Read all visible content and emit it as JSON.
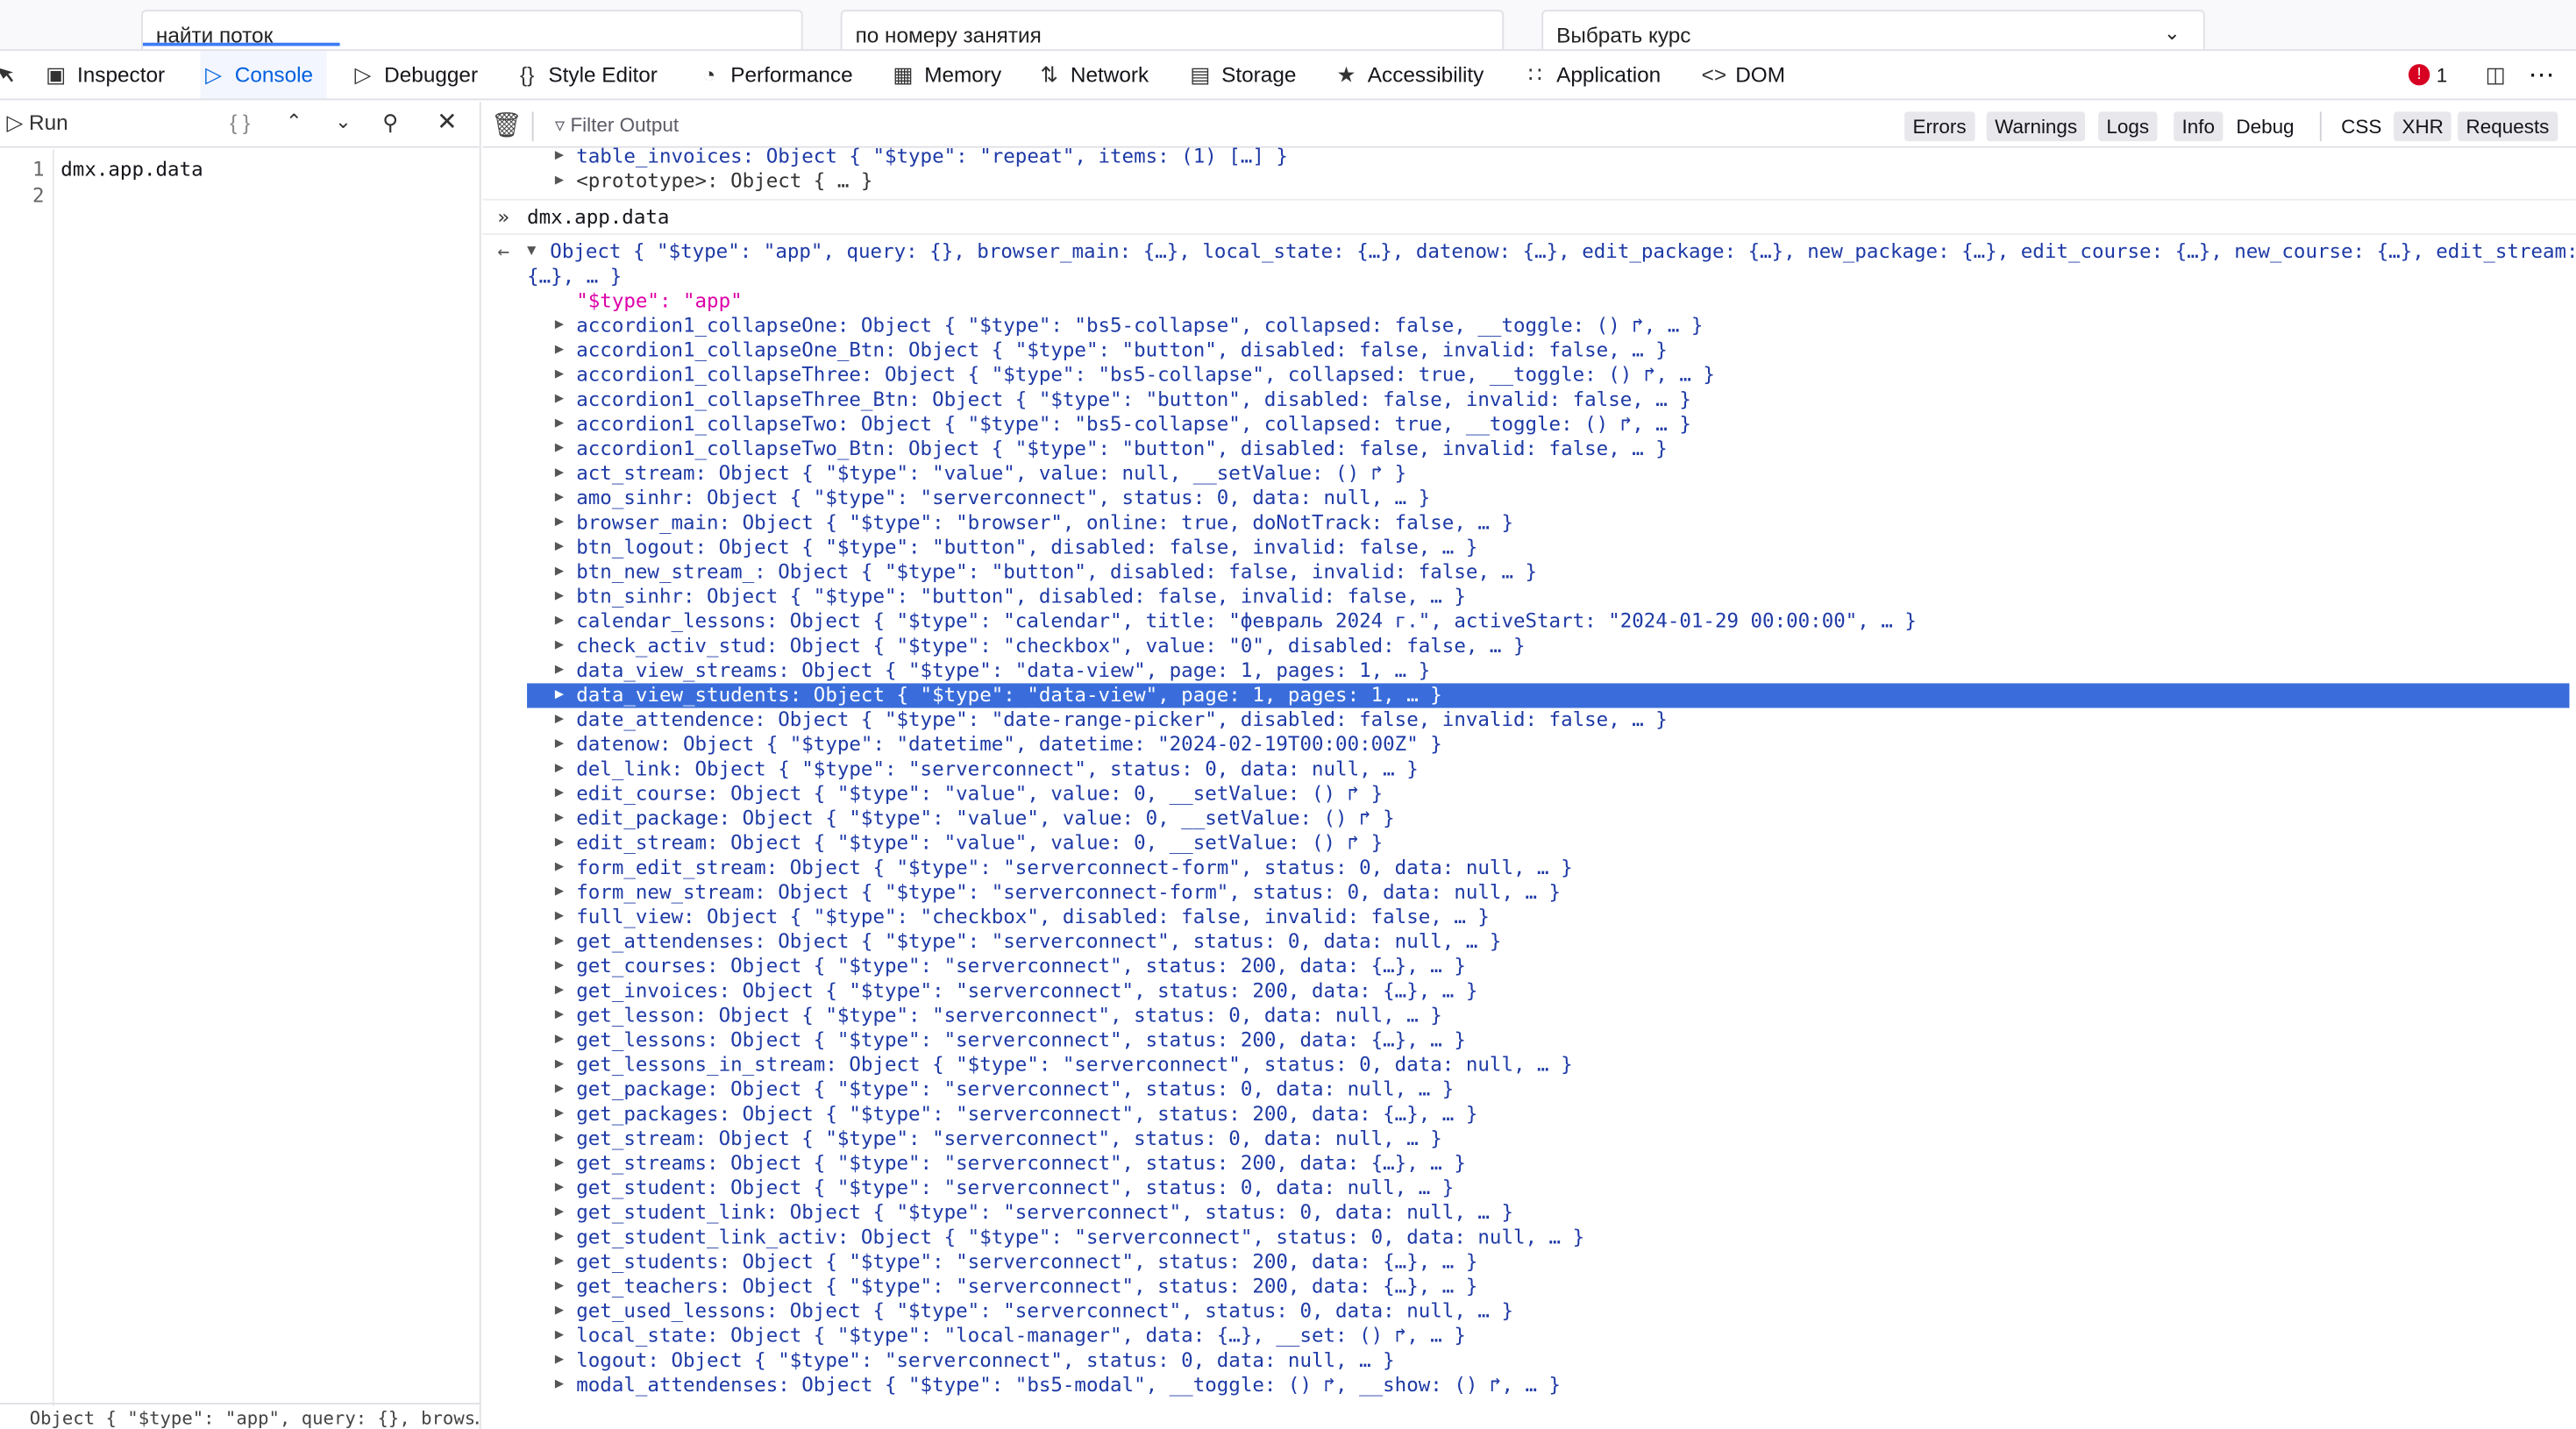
{
  "page": {
    "inputs": [
      {
        "value": "найти поток"
      },
      {
        "value": "по номеру занятия"
      },
      {
        "value": "Выбрать курс"
      }
    ]
  },
  "toolbar": {
    "tabs": [
      {
        "label": "Inspector",
        "icon": "inspector-icon"
      },
      {
        "label": "Console",
        "icon": "console-icon"
      },
      {
        "label": "Debugger",
        "icon": "debugger-icon"
      },
      {
        "label": "Style Editor",
        "icon": "style-editor-icon"
      },
      {
        "label": "Performance",
        "icon": "performance-icon"
      },
      {
        "label": "Memory",
        "icon": "memory-icon"
      },
      {
        "label": "Network",
        "icon": "network-icon"
      },
      {
        "label": "Storage",
        "icon": "storage-icon"
      },
      {
        "label": "Accessibility",
        "icon": "accessibility-icon"
      },
      {
        "label": "Application",
        "icon": "application-icon"
      },
      {
        "label": "DOM",
        "icon": "dom-icon"
      }
    ],
    "error_count": "1",
    "active_tab": "Console"
  },
  "editor": {
    "run_label": "Run",
    "braces": "{ }",
    "lines": [
      "1",
      "2"
    ],
    "code": "dmx.app.data",
    "footer": "Object { \"$type\": \"app\", query: {}, brows…"
  },
  "filter": {
    "placeholder": "Filter Output",
    "buttons": [
      "Errors",
      "Warnings",
      "Logs",
      "Info",
      "Debug"
    ],
    "net_buttons": [
      "CSS",
      "XHR",
      "Requests"
    ]
  },
  "log": {
    "prev1": "table_invoices: Object { \"$type\": \"repeat\", items: (1) […] }",
    "prev2": "<prototype>: Object { … }",
    "input": "dmx.app.data",
    "result_line1": "Object { \"$type\": \"app\", query: {}, browser_main: {…}, local_state: {…}, datenow: {…}, edit_package: {…}, new_package: {…}, edit_course: {…}, new_course: {…}, edit_stream:",
    "result_line2": "{…}, … }",
    "type_line": "\"$type\": \"app\"",
    "selected": "data_view_students",
    "entries": [
      "accordion1_collapseOne: Object { \"$type\": \"bs5-collapse\", collapsed: false, __toggle: () ↱, … }",
      "accordion1_collapseOne_Btn: Object { \"$type\": \"button\", disabled: false, invalid: false, … }",
      "accordion1_collapseThree: Object { \"$type\": \"bs5-collapse\", collapsed: true, __toggle: () ↱, … }",
      "accordion1_collapseThree_Btn: Object { \"$type\": \"button\", disabled: false, invalid: false, … }",
      "accordion1_collapseTwo: Object { \"$type\": \"bs5-collapse\", collapsed: true, __toggle: () ↱, … }",
      "accordion1_collapseTwo_Btn: Object { \"$type\": \"button\", disabled: false, invalid: false, … }",
      "act_stream: Object { \"$type\": \"value\", value: null, __setValue: () ↱ }",
      "amo_sinhr: Object { \"$type\": \"serverconnect\", status: 0, data: null, … }",
      "browser_main: Object { \"$type\": \"browser\", online: true, doNotTrack: false, … }",
      "btn_logout: Object { \"$type\": \"button\", disabled: false, invalid: false, … }",
      "btn_new_stream_: Object { \"$type\": \"button\", disabled: false, invalid: false, … }",
      "btn_sinhr: Object { \"$type\": \"button\", disabled: false, invalid: false, … }",
      "calendar_lessons: Object { \"$type\": \"calendar\", title: \"февраль 2024 г.\", activeStart: \"2024-01-29 00:00:00\", … }",
      "check_activ_stud: Object { \"$type\": \"checkbox\", value: \"0\", disabled: false, … }",
      "data_view_streams: Object { \"$type\": \"data-view\", page: 1, pages: 1, … }",
      "data_view_students: Object { \"$type\": \"data-view\", page: 1, pages: 1, … }",
      "date_attendence: Object { \"$type\": \"date-range-picker\", disabled: false, invalid: false, … }",
      "datenow: Object { \"$type\": \"datetime\", datetime: \"2024-02-19T00:00:00Z\" }",
      "del_link: Object { \"$type\": \"serverconnect\", status: 0, data: null, … }",
      "edit_course: Object { \"$type\": \"value\", value: 0, __setValue: () ↱ }",
      "edit_package: Object { \"$type\": \"value\", value: 0, __setValue: () ↱ }",
      "edit_stream: Object { \"$type\": \"value\", value: 0, __setValue: () ↱ }",
      "form_edit_stream: Object { \"$type\": \"serverconnect-form\", status: 0, data: null, … }",
      "form_new_stream: Object { \"$type\": \"serverconnect-form\", status: 0, data: null, … }",
      "full_view: Object { \"$type\": \"checkbox\", disabled: false, invalid: false, … }",
      "get_attendenses: Object { \"$type\": \"serverconnect\", status: 0, data: null, … }",
      "get_courses: Object { \"$type\": \"serverconnect\", status: 200, data: {…}, … }",
      "get_invoices: Object { \"$type\": \"serverconnect\", status: 200, data: {…}, … }",
      "get_lesson: Object { \"$type\": \"serverconnect\", status: 0, data: null, … }",
      "get_lessons: Object { \"$type\": \"serverconnect\", status: 200, data: {…}, … }",
      "get_lessons_in_stream: Object { \"$type\": \"serverconnect\", status: 0, data: null, … }",
      "get_package: Object { \"$type\": \"serverconnect\", status: 0, data: null, … }",
      "get_packages: Object { \"$type\": \"serverconnect\", status: 200, data: {…}, … }",
      "get_stream: Object { \"$type\": \"serverconnect\", status: 0, data: null, … }",
      "get_streams: Object { \"$type\": \"serverconnect\", status: 200, data: {…}, … }",
      "get_student: Object { \"$type\": \"serverconnect\", status: 0, data: null, … }",
      "get_student_link: Object { \"$type\": \"serverconnect\", status: 0, data: null, … }",
      "get_student_link_activ: Object { \"$type\": \"serverconnect\", status: 0, data: null, … }",
      "get_students: Object { \"$type\": \"serverconnect\", status: 200, data: {…}, … }",
      "get_teachers: Object { \"$type\": \"serverconnect\", status: 200, data: {…}, … }",
      "get_used_lessons: Object { \"$type\": \"serverconnect\", status: 0, data: null, … }",
      "local_state: Object { \"$type\": \"local-manager\", data: {…}, __set: () ↱, … }",
      "logout: Object { \"$type\": \"serverconnect\", status: 0, data: null, … }",
      "modal_attendenses: Object { \"$type\": \"bs5-modal\", __toggle: () ↱, __show: () ↱, … }"
    ]
  }
}
